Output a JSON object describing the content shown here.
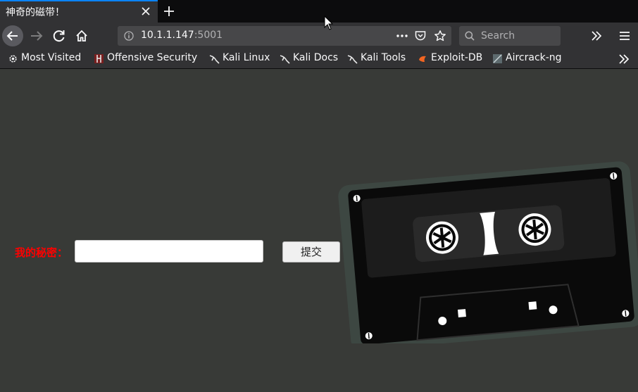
{
  "browser": {
    "tab": {
      "title": "神奇的磁带！"
    },
    "url": {
      "host": "10.1.1.147",
      "port": ":5001"
    },
    "search": {
      "placeholder": "Search"
    },
    "bookmarks": [
      {
        "label": "Most Visited",
        "icon": "gear-icon"
      },
      {
        "label": "Offensive Security",
        "icon": "offsec-icon"
      },
      {
        "label": "Kali Linux",
        "icon": "kali-dragon-icon"
      },
      {
        "label": "Kali Docs",
        "icon": "kali-dragon-icon"
      },
      {
        "label": "Kali Tools",
        "icon": "kali-dragon-icon"
      },
      {
        "label": "Exploit-DB",
        "icon": "exploitdb-icon"
      },
      {
        "label": "Aircrack-ng",
        "icon": "aircrack-icon"
      }
    ]
  },
  "page": {
    "secret_label": "我的秘密：",
    "secret_input_value": "",
    "submit_label": "提交"
  },
  "colors": {
    "page_bg": "#383a37",
    "label_red": "#ff0000",
    "tab_accent": "#0a84ff"
  }
}
